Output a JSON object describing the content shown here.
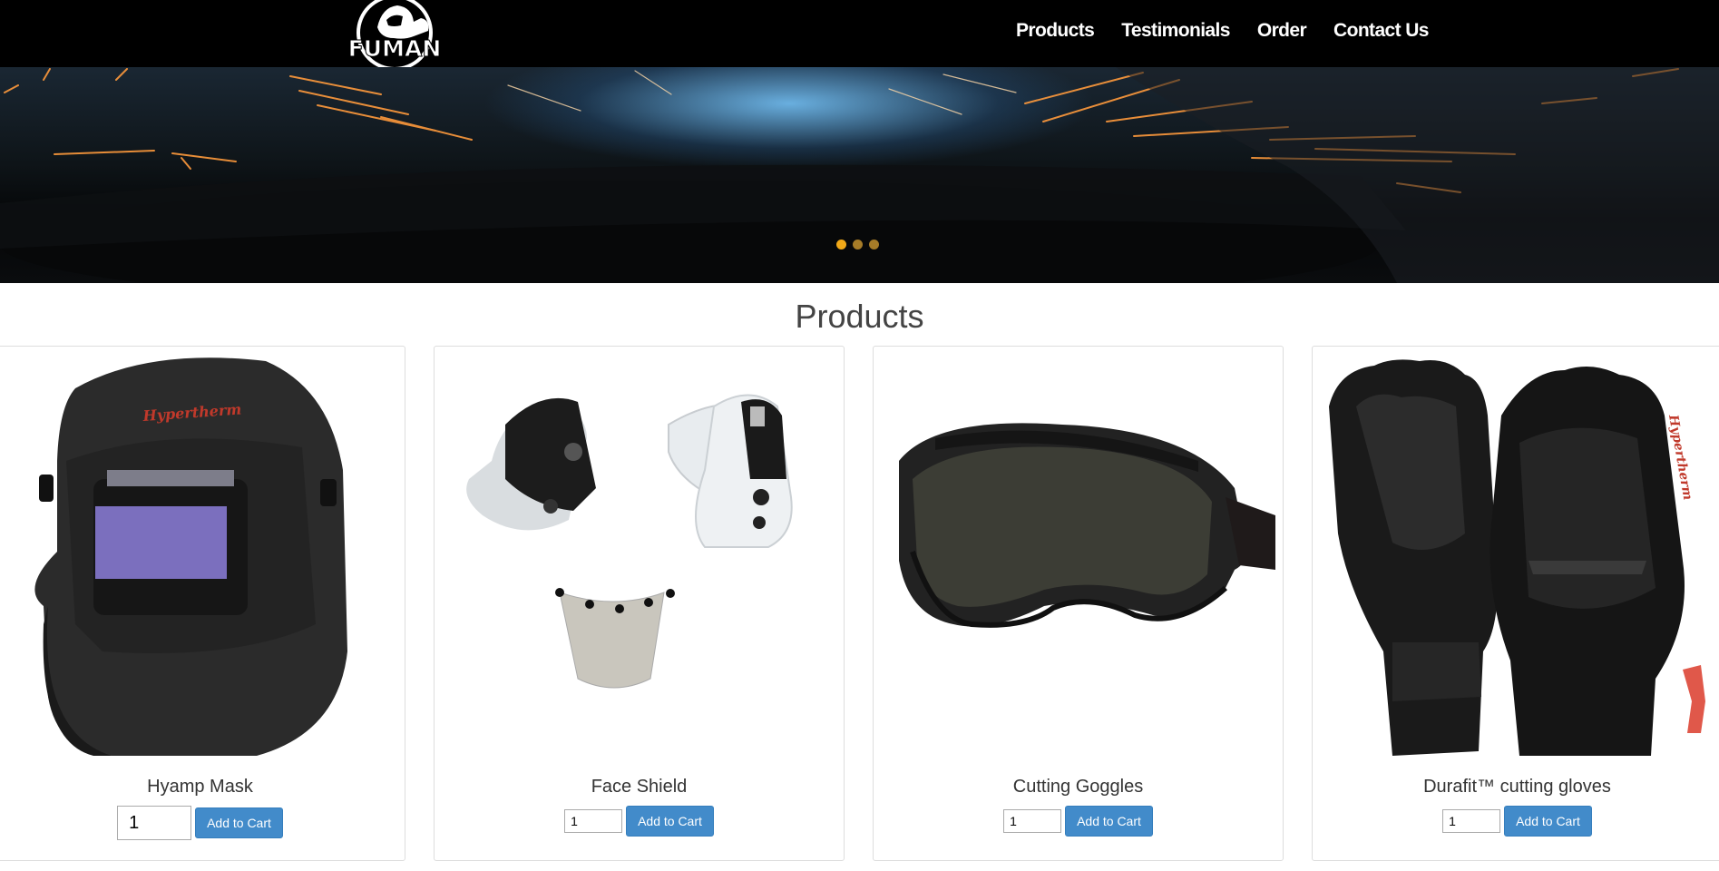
{
  "brand": {
    "logo_text": "FUMAN"
  },
  "nav": {
    "items": [
      {
        "label": "Products"
      },
      {
        "label": "Testimonials"
      },
      {
        "label": "Order"
      },
      {
        "label": "Contact Us"
      }
    ]
  },
  "hero": {
    "slide_count": 3,
    "active_slide": 1
  },
  "products_section": {
    "title": "Products",
    "items": [
      {
        "name": "Hyamp Mask",
        "qty": "1",
        "button": "Add to Cart",
        "brand_mark": "Hypertherm"
      },
      {
        "name": "Face Shield",
        "qty": "1",
        "button": "Add to Cart"
      },
      {
        "name": "Cutting Goggles",
        "qty": "1",
        "button": "Add to Cart"
      },
      {
        "name": "Durafit™ cutting gloves",
        "qty": "1",
        "button": "Add to Cart",
        "brand_mark": "Hypertherm"
      }
    ]
  },
  "colors": {
    "nav_bg": "#000000",
    "button": "#428bca",
    "dot_active": "#f0a818",
    "dot": "#a67c28",
    "brand_red": "#c0392b"
  }
}
